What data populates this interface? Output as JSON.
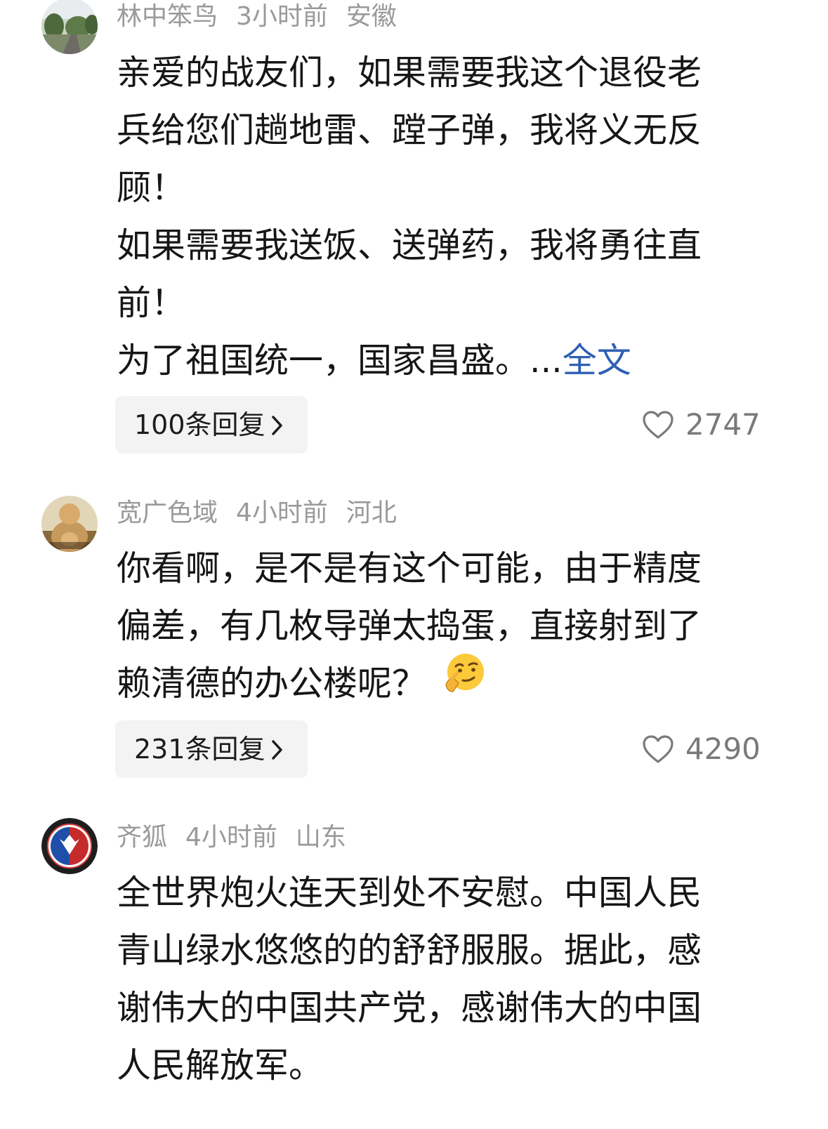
{
  "comments": [
    {
      "user": "林中笨鸟",
      "time": "3小时前",
      "location": "安徽",
      "lines": [
        "亲爱的战友们，如果需要我这个退役老",
        "兵给您们趟地雷、蹚子弹，我将义无反",
        "顾！",
        "如果需要我送饭、送弹药，我将勇往直",
        "前！",
        "为了祖国统一，国家昌盛。..."
      ],
      "more_label": "全文",
      "replies": "100条回复",
      "likes": "2747"
    },
    {
      "user": "宽广色域",
      "time": "4小时前",
      "location": "河北",
      "lines": [
        "你看啊，是不是有这个可能，由于精度",
        "偏差，有几枚导弹太捣蛋，直接射到了",
        "赖清德的办公楼呢？"
      ],
      "emoji": "thinking-smirk-emoji",
      "replies": "231条回复",
      "likes": "4290"
    },
    {
      "user": "齐狐",
      "time": "4小时前",
      "location": "山东",
      "lines": [
        "全世界炮火连天到处不安慰。中国人民",
        "青山绿水悠悠的的舒舒服服。据此，感",
        "谢伟大的中国共产党，感谢伟大的中国",
        "人民解放军。"
      ]
    }
  ],
  "colors": {
    "meta": "#9a9a9a",
    "link": "#2f5fb3",
    "reply_bg": "#f3f3f3"
  },
  "icons": {
    "like": "heart-outline-icon",
    "reply_arrow": "chevron-right-icon"
  }
}
